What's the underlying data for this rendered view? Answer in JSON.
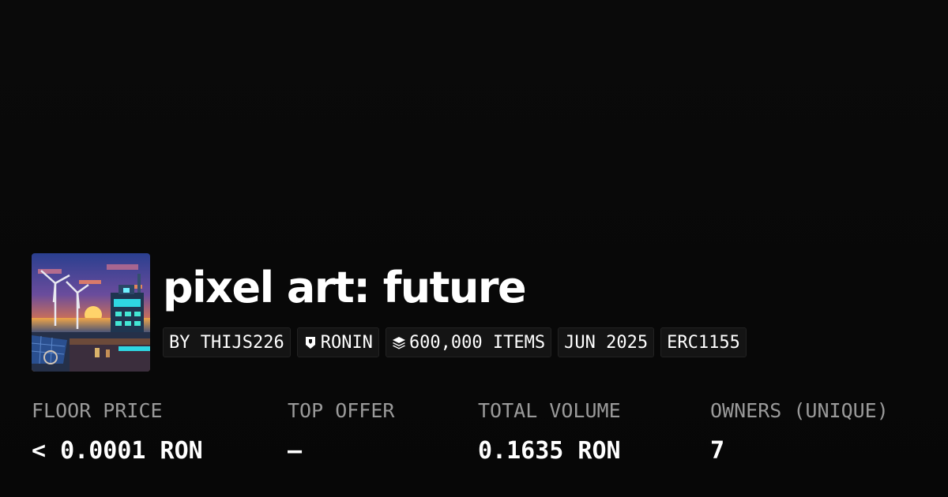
{
  "collection": {
    "title": "pixel art: future",
    "image_alt": "pixel art futuristic city with wind turbines at sunset",
    "chips": {
      "creator": "BY THIJS226",
      "chain": "RONIN",
      "items": "600,000 ITEMS",
      "date": "JUN 2025",
      "standard": "ERC1155"
    },
    "icons": {
      "chain": "ronin-shield-icon",
      "items": "layers-icon"
    }
  },
  "stats": {
    "floor_price": {
      "label": "FLOOR PRICE",
      "value": "< 0.0001 RON"
    },
    "top_offer": {
      "label": "TOP OFFER",
      "value": "–"
    },
    "total_volume": {
      "label": "TOTAL VOLUME",
      "value": "0.1635 RON"
    },
    "owners": {
      "label": "OWNERS (UNIQUE)",
      "value": "7"
    }
  },
  "colors": {
    "background": "#0a0a0a",
    "chip_bg": "#141414",
    "chip_border": "#222222",
    "label": "#9a9a9a",
    "text": "#ffffff"
  }
}
